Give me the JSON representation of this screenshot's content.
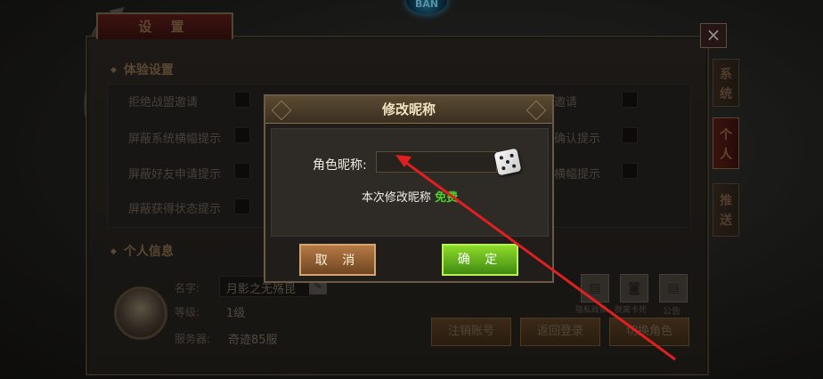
{
  "emblem": {
    "text": "BAN"
  },
  "settings": {
    "title": "设 置",
    "close": "×",
    "section_experience": "体验设置",
    "options_left": [
      "拒绝战盟邀请",
      "屏蔽系统横幅提示",
      "屏蔽好友申请提示",
      "屏蔽获得状态提示"
    ],
    "options_right": [
      "邀请",
      "确认提示",
      "横幅提示"
    ],
    "section_personal": "个人信息",
    "name_label": "名字:",
    "name_value": "月影之无殇昆",
    "level_label": "等级:",
    "level_value": "1级",
    "server_label": "服务器:",
    "server_value": "奇迹85服",
    "icons": [
      {
        "label": "隐私政策",
        "icon": "document-icon"
      },
      {
        "label": "脱离卡死",
        "icon": "unstuck-icon"
      },
      {
        "label": "公告",
        "icon": "notice-icon"
      }
    ],
    "buttons": [
      "注销账号",
      "返回登录",
      "切换角色"
    ]
  },
  "side_tabs": [
    {
      "label": "系统",
      "active": false
    },
    {
      "label": "个人",
      "active": true
    },
    {
      "label": "推送",
      "active": false
    }
  ],
  "dialog": {
    "title": "修改昵称",
    "nick_label": "角色昵称:",
    "nick_value": "",
    "free_prefix": "本次修改昵称",
    "free_text": "免费",
    "cancel": "取 消",
    "confirm": "确 定"
  },
  "colors": {
    "free_green": "#4ad22a",
    "annotation_red": "#e02020"
  }
}
